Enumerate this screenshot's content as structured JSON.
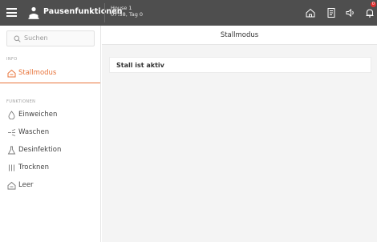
{
  "header": {
    "title": "Pausenfunktionen",
    "house_line1": "House 1",
    "house_line2": "07:58, Tag 0",
    "badge_count": "0"
  },
  "sidebar": {
    "search_placeholder": "Suchen",
    "sections": [
      {
        "label": "INFO",
        "items": [
          {
            "label": "Stallmodus",
            "icon": "house-icon",
            "active": true
          }
        ]
      },
      {
        "label": "FUNKTIONEN",
        "items": [
          {
            "label": "Einweichen",
            "icon": "drop-icon"
          },
          {
            "label": "Waschen",
            "icon": "spray-icon"
          },
          {
            "label": "Desinfektion",
            "icon": "flask-icon"
          },
          {
            "label": "Trocknen",
            "icon": "heater-icon"
          },
          {
            "label": "Leer",
            "icon": "house-icon"
          }
        ]
      }
    ]
  },
  "main": {
    "title": "Stallmodus",
    "status_text": "Stall ist aktiv"
  },
  "colors": {
    "accent": "#e8743b",
    "topbar": "#4e4e4e",
    "badge": "#e03131"
  }
}
